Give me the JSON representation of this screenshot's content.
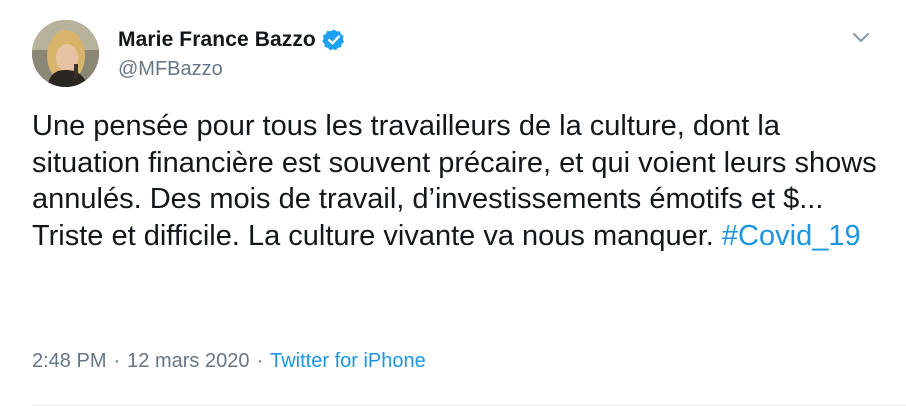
{
  "author": {
    "display_name": "Marie France Bazzo",
    "handle": "@MFBazzo",
    "verified": true
  },
  "tweet": {
    "text": "Une pensée pour tous les travailleurs de la culture, dont la situation financière est souvent précaire, et qui voient leurs shows annulés. Des mois de travail, d’investissements émotifs et $... Triste et difficile. La culture vivante va nous manquer. ",
    "hashtag": "#Covid_19"
  },
  "meta": {
    "time": "2:48 PM",
    "separator": "·",
    "date": "12 mars 2020",
    "source": "Twitter for iPhone"
  },
  "icons": {
    "verified": "verified-badge-icon",
    "caret": "chevron-down-icon"
  },
  "colors": {
    "accent": "#1b95e0",
    "secondary_text": "#657786",
    "primary_text": "#14171a"
  }
}
